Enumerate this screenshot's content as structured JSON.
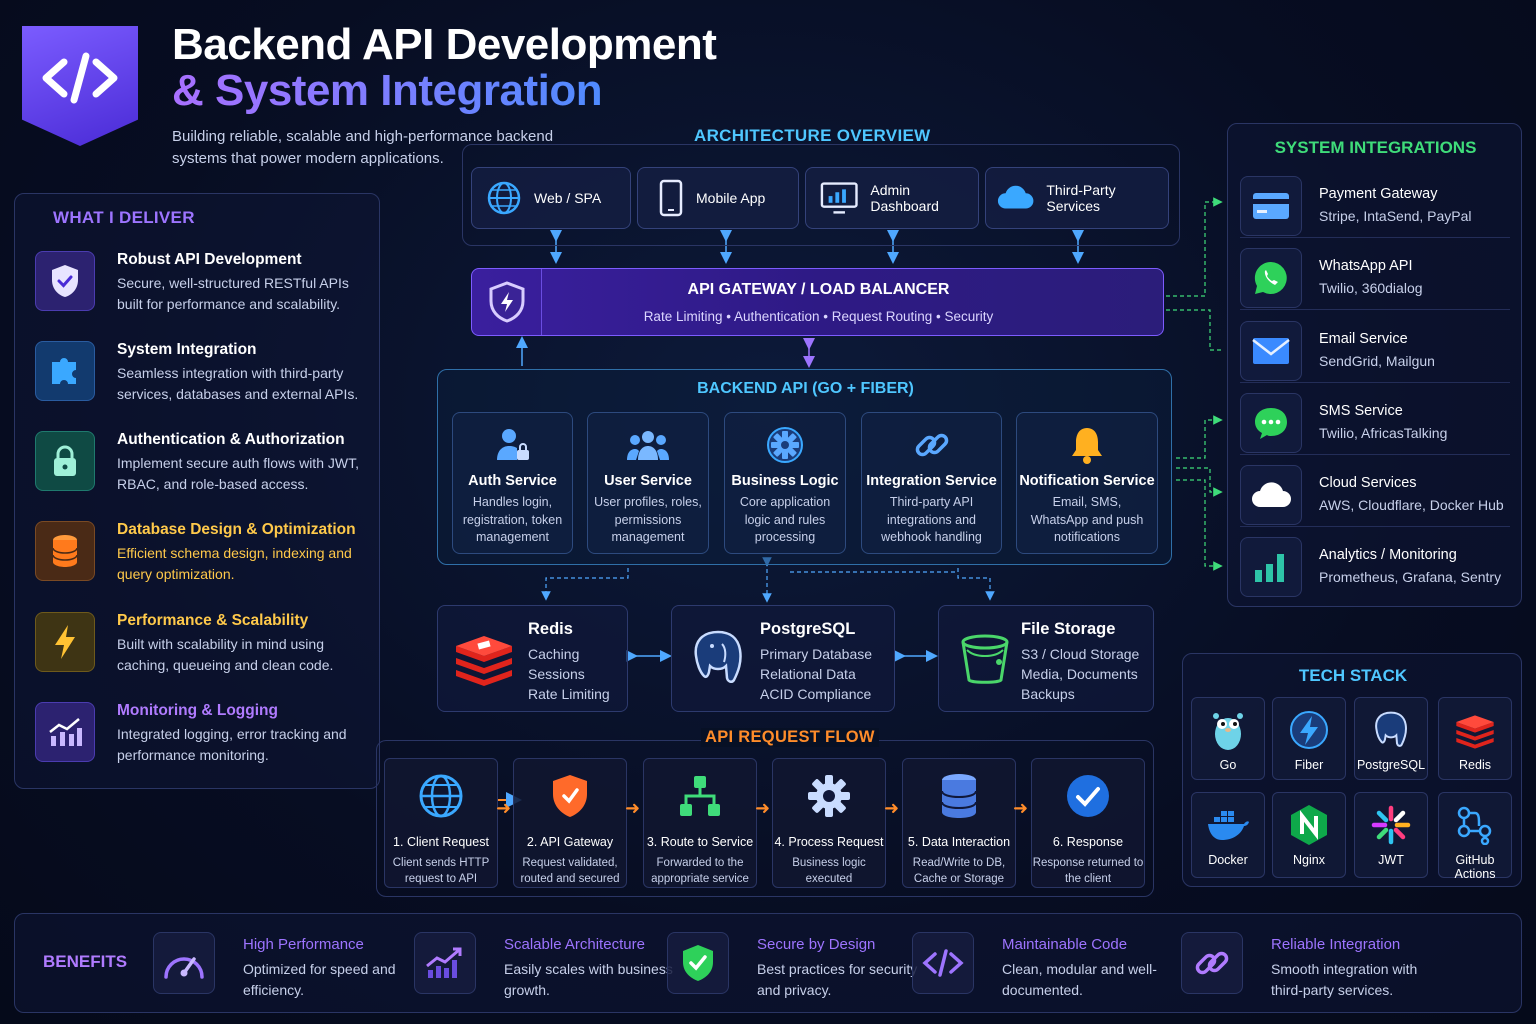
{
  "header": {
    "title_line1": "Backend API Development",
    "title_line2": "& System Integration",
    "subtitle": "Building reliable, scalable and high-performance backend systems that power modern applications."
  },
  "deliver": {
    "title": "WHAT I DELIVER",
    "items": [
      {
        "title": "Robust API Development",
        "desc": "Secure, well-structured RESTful APIs built for performance and scalability.",
        "icon": "shield-check-icon",
        "color": "#ffffff"
      },
      {
        "title": "System Integration",
        "desc": "Seamless integration with third-party services, databases and external APIs.",
        "icon": "puzzle-icon",
        "color": "#ffffff"
      },
      {
        "title": "Authentication & Authorization",
        "desc": "Implement secure auth flows with JWT, RBAC, and role-based access.",
        "icon": "lock-icon",
        "color": "#ffffff"
      },
      {
        "title": "Database Design & Optimization",
        "desc": "Efficient schema design, indexing and query optimization.",
        "icon": "database-icon",
        "color": "#ffc94a"
      },
      {
        "title": "Performance & Scalability",
        "desc": "Built with scalability in mind using caching, queueing and clean code.",
        "icon": "lightning-icon",
        "color": "#ffc94a"
      },
      {
        "title": "Monitoring & Logging",
        "desc": "Integrated logging, error tracking and performance monitoring.",
        "icon": "chart-trend-icon",
        "color": "#b07bff"
      }
    ]
  },
  "architecture": {
    "title": "ARCHITECTURE OVERVIEW",
    "clients": [
      "Web / SPA",
      "Mobile App",
      "Admin Dashboard",
      "Third-Party Services"
    ],
    "gateway": {
      "title": "API GATEWAY / LOAD BALANCER",
      "sub": "Rate Limiting • Authentication • Request Routing • Security"
    },
    "backend": {
      "title": "BACKEND API (GO + FIBER)",
      "services": [
        {
          "title": "Auth Service",
          "desc": "Handles login, registration, token management"
        },
        {
          "title": "User Service",
          "desc": "User profiles, roles, permissions management"
        },
        {
          "title": "Business Logic",
          "desc": "Core application logic and rules processing"
        },
        {
          "title": "Integration Service",
          "desc": "Third-party API integrations and webhook handling"
        },
        {
          "title": "Notification Service",
          "desc": "Email, SMS, WhatsApp and push notifications"
        }
      ]
    },
    "storage": [
      {
        "title": "Redis",
        "lines": [
          "Caching",
          "Sessions",
          "Rate Limiting"
        ]
      },
      {
        "title": "PostgreSQL",
        "lines": [
          "Primary Database",
          "Relational Data",
          "ACID Compliance"
        ]
      },
      {
        "title": "File Storage",
        "lines": [
          "S3 / Cloud Storage",
          "Media, Documents",
          "Backups"
        ]
      }
    ]
  },
  "flow": {
    "title": "API REQUEST FLOW",
    "steps": [
      {
        "title": "1. Client Request",
        "desc": "Client sends HTTP request to API"
      },
      {
        "title": "2. API Gateway",
        "desc": "Request validated, routed and secured"
      },
      {
        "title": "3. Route to Service",
        "desc": "Forwarded to the appropriate service"
      },
      {
        "title": "4. Process Request",
        "desc": "Business logic executed"
      },
      {
        "title": "5. Data Interaction",
        "desc": "Read/Write to DB, Cache or Storage"
      },
      {
        "title": "6. Response",
        "desc": "Response returned to the client"
      }
    ]
  },
  "integrations": {
    "title": "SYSTEM INTEGRATIONS",
    "items": [
      {
        "title": "Payment Gateway",
        "desc": "Stripe, IntaSend, PayPal"
      },
      {
        "title": "WhatsApp API",
        "desc": "Twilio, 360dialog"
      },
      {
        "title": "Email Service",
        "desc": "SendGrid, Mailgun"
      },
      {
        "title": "SMS Service",
        "desc": "Twilio, AfricasTalking"
      },
      {
        "title": "Cloud Services",
        "desc": "AWS, Cloudflare, Docker Hub"
      },
      {
        "title": "Analytics / Monitoring",
        "desc": "Prometheus, Grafana, Sentry"
      }
    ]
  },
  "tech": {
    "title": "TECH STACK",
    "items": [
      "Go",
      "Fiber",
      "PostgreSQL",
      "Redis",
      "Docker",
      "Nginx",
      "JWT",
      "GitHub Actions"
    ]
  },
  "benefits": {
    "title": "BENEFITS",
    "items": [
      {
        "title": "High Performance",
        "desc": "Optimized for speed and efficiency."
      },
      {
        "title": "Scalable Architecture",
        "desc": "Easily scales with business growth."
      },
      {
        "title": "Secure by Design",
        "desc": "Best practices for security and privacy."
      },
      {
        "title": "Maintainable Code",
        "desc": "Clean, modular and well-documented."
      },
      {
        "title": "Reliable Integration",
        "desc": "Smooth integration with third-party services."
      }
    ]
  },
  "colors": {
    "accent_purple": "#9d74ff",
    "accent_blue": "#4fc7ff",
    "accent_green": "#3fdc7a",
    "accent_orange": "#ff8c2a"
  }
}
